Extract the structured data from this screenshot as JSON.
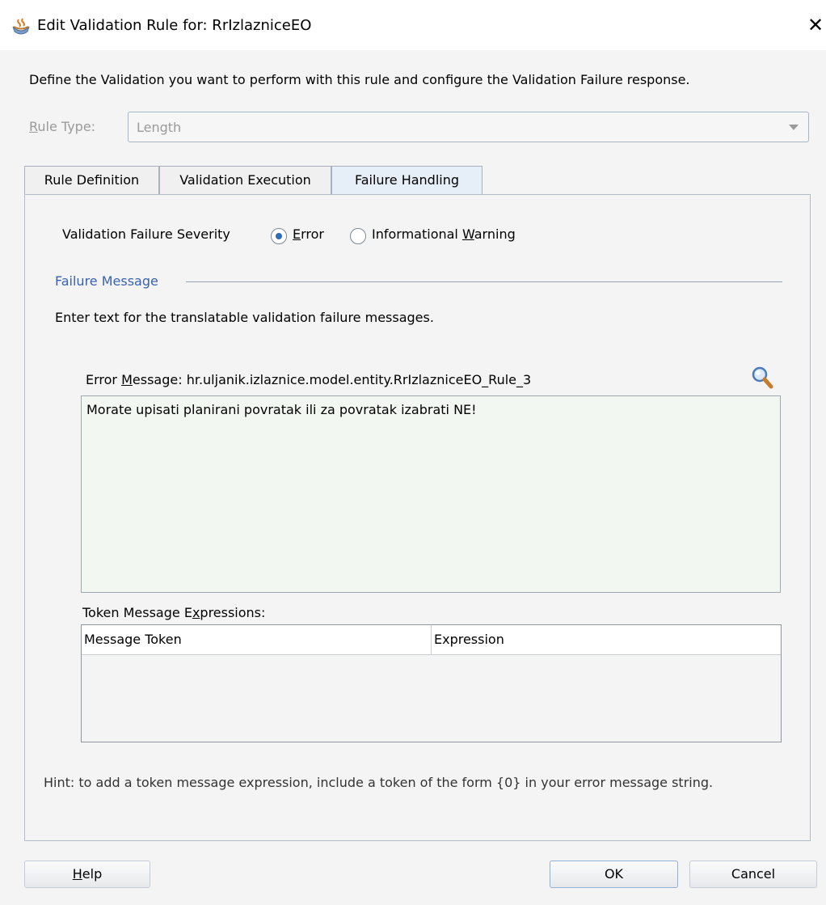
{
  "window": {
    "title": "Edit Validation Rule for: RrIzlazniceEO",
    "close_glyph": "✕",
    "icon": "java-cup-icon"
  },
  "description": "Define the Validation you want to perform with this rule and configure the Validation Failure response.",
  "rule_type": {
    "label_mnemonic": "R",
    "label_rest": "ule Type:",
    "value": "Length",
    "disabled": true
  },
  "tabs": [
    {
      "label": "Rule Definition",
      "active": false
    },
    {
      "label": "Validation Execution",
      "active": false
    },
    {
      "label": "Failure Handling",
      "active": true
    }
  ],
  "severity": {
    "label": "Validation Failure Severity",
    "options": [
      {
        "pre": "",
        "mnemonic": "E",
        "post": "rror",
        "selected": true
      },
      {
        "pre": "Informational ",
        "mnemonic": "W",
        "post": "arning",
        "selected": false
      }
    ]
  },
  "failure_message": {
    "section_title": "Failure Message",
    "instruction": "Enter text for the translatable validation failure messages.",
    "error_label_pre": "Error ",
    "error_label_mnemonic": "M",
    "error_label_post": "essage: hr.uljanik.izlaznice.model.entity.RrIzlazniceEO_Rule_3",
    "message_text": "Morate upisati planirani povratak ili za povratak izabrati NE!",
    "search_icon": "magnifier-icon"
  },
  "token_expressions": {
    "label_pre": "Token Message E",
    "label_mnemonic": "x",
    "label_post": "pressions:",
    "columns": [
      "Message Token",
      "Expression"
    ],
    "rows": []
  },
  "hint": "Hint: to add a token message expression, include a token of the form {0} in your error message string.",
  "buttons": {
    "help_mnemonic": "H",
    "help_rest": "elp",
    "ok": "OK",
    "cancel": "Cancel"
  },
  "colors": {
    "section_title": "#3a62b0",
    "radio_selected": "#2e6bb8",
    "message_bg": "#f2f7f2",
    "active_tab_bg": "#e6eef8"
  }
}
